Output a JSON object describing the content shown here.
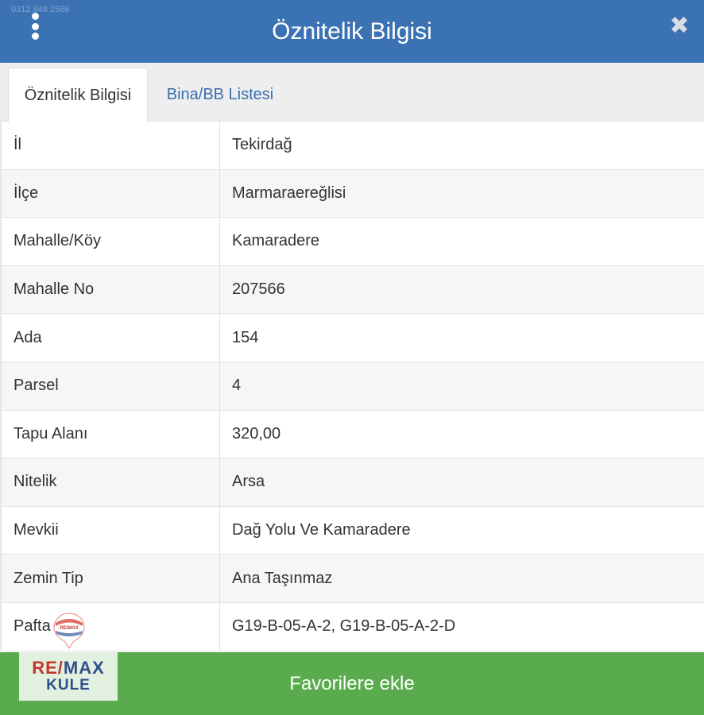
{
  "header": {
    "title": "Öznitelik Bilgisi",
    "close_glyph": "✖",
    "faint_text": "0312 848 2566"
  },
  "tabs": [
    {
      "label": "Öznitelik Bilgisi",
      "active": true
    },
    {
      "label": "Bina/BB Listesi",
      "active": false
    }
  ],
  "attributes": [
    {
      "label": "İl",
      "value": "Tekirdağ"
    },
    {
      "label": "İlçe",
      "value": "Marmaraereğlisi"
    },
    {
      "label": "Mahalle/Köy",
      "value": "Kamaradere"
    },
    {
      "label": "Mahalle No",
      "value": "207566"
    },
    {
      "label": "Ada",
      "value": "154"
    },
    {
      "label": "Parsel",
      "value": "4"
    },
    {
      "label": "Tapu Alanı",
      "value": "320,00"
    },
    {
      "label": "Nitelik",
      "value": "Arsa"
    },
    {
      "label": "Mevkii",
      "value": "Dağ Yolu Ve Kamaradere"
    },
    {
      "label": "Zemin Tip",
      "value": "Ana Taşınmaz"
    },
    {
      "label": "Pafta",
      "value": "G19-B-05-A-2, G19-B-05-A-2-D"
    }
  ],
  "footer": {
    "button_label": "Favorilere ekle"
  },
  "watermark": {
    "brand_re": "RE",
    "brand_slash": "/",
    "brand_max": "MAX",
    "sub": "KULE",
    "balloon_text": "RE/MAX"
  },
  "colors": {
    "header_bg": "#3b72b3",
    "footer_bg": "#5aab4d",
    "tab_link": "#3a6fb0"
  },
  "icons": {
    "menu": "vertical-dots-icon",
    "close": "close-icon"
  }
}
